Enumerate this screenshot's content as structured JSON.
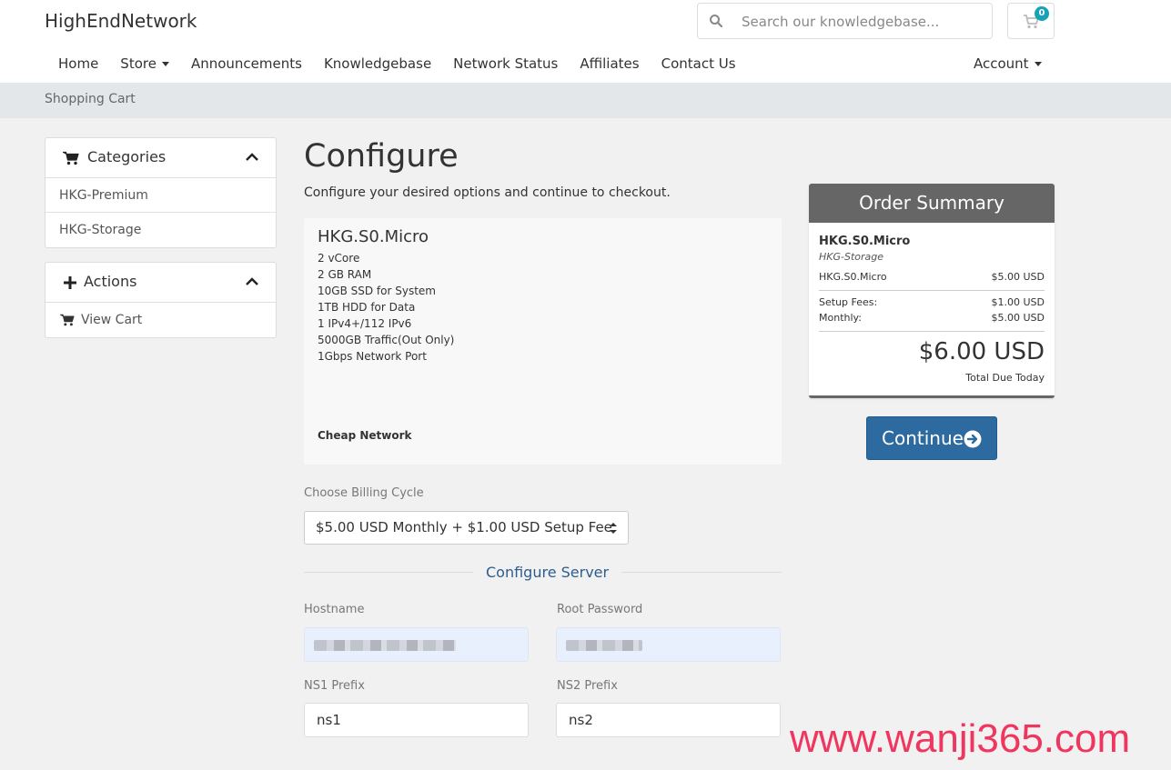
{
  "brand": "HighEndNetwork",
  "search": {
    "placeholder": "Search our knowledgebase..."
  },
  "cart": {
    "count": "0"
  },
  "nav": {
    "items": [
      "Home",
      "Store",
      "Announcements",
      "Knowledgebase",
      "Network Status",
      "Affiliates",
      "Contact Us"
    ],
    "account": "Account"
  },
  "breadcrumb": "Shopping Cart",
  "sidebar": {
    "categories": {
      "title": "Categories",
      "items": [
        "HKG-Premium",
        "HKG-Storage"
      ]
    },
    "actions": {
      "title": "Actions",
      "items": [
        "View Cart"
      ]
    }
  },
  "main": {
    "title": "Configure",
    "subtitle": "Configure your desired options and continue to checkout.",
    "product": {
      "name": "HKG.S0.Micro",
      "specs": [
        "2 vCore",
        "2 GB RAM",
        "10GB SSD for System",
        "1TB HDD for Data",
        "1 IPv4+/112 IPv6",
        "5000GB Traffic(Out Only)",
        "1Gbps Network Port"
      ],
      "tagline": "Cheap Network"
    },
    "billing": {
      "label": "Choose Billing Cycle",
      "selected": "$5.00 USD Monthly + $1.00 USD Setup Fee"
    },
    "configure_server": {
      "heading": "Configure Server",
      "hostname_label": "Hostname",
      "root_password_label": "Root Password",
      "ns1_label": "NS1 Prefix",
      "ns1_value": "ns1",
      "ns2_label": "NS2 Prefix",
      "ns2_value": "ns2"
    }
  },
  "summary": {
    "heading": "Order Summary",
    "product": "HKG.S0.Micro",
    "group": "HKG-Storage",
    "line_item": {
      "label": "HKG.S0.Micro",
      "amount": "$5.00 USD"
    },
    "setup_fees": {
      "label": "Setup Fees:",
      "amount": "$1.00 USD"
    },
    "monthly": {
      "label": "Monthly:",
      "amount": "$5.00 USD"
    },
    "total": "$6.00 USD",
    "total_label": "Total Due Today"
  },
  "continue_label": "Continue",
  "watermark": "www.wanji365.com",
  "colors": {
    "accent": "#2c6aa0",
    "summary_header": "#666666",
    "badge": "#17a2b8",
    "watermark": "#f0365f"
  }
}
